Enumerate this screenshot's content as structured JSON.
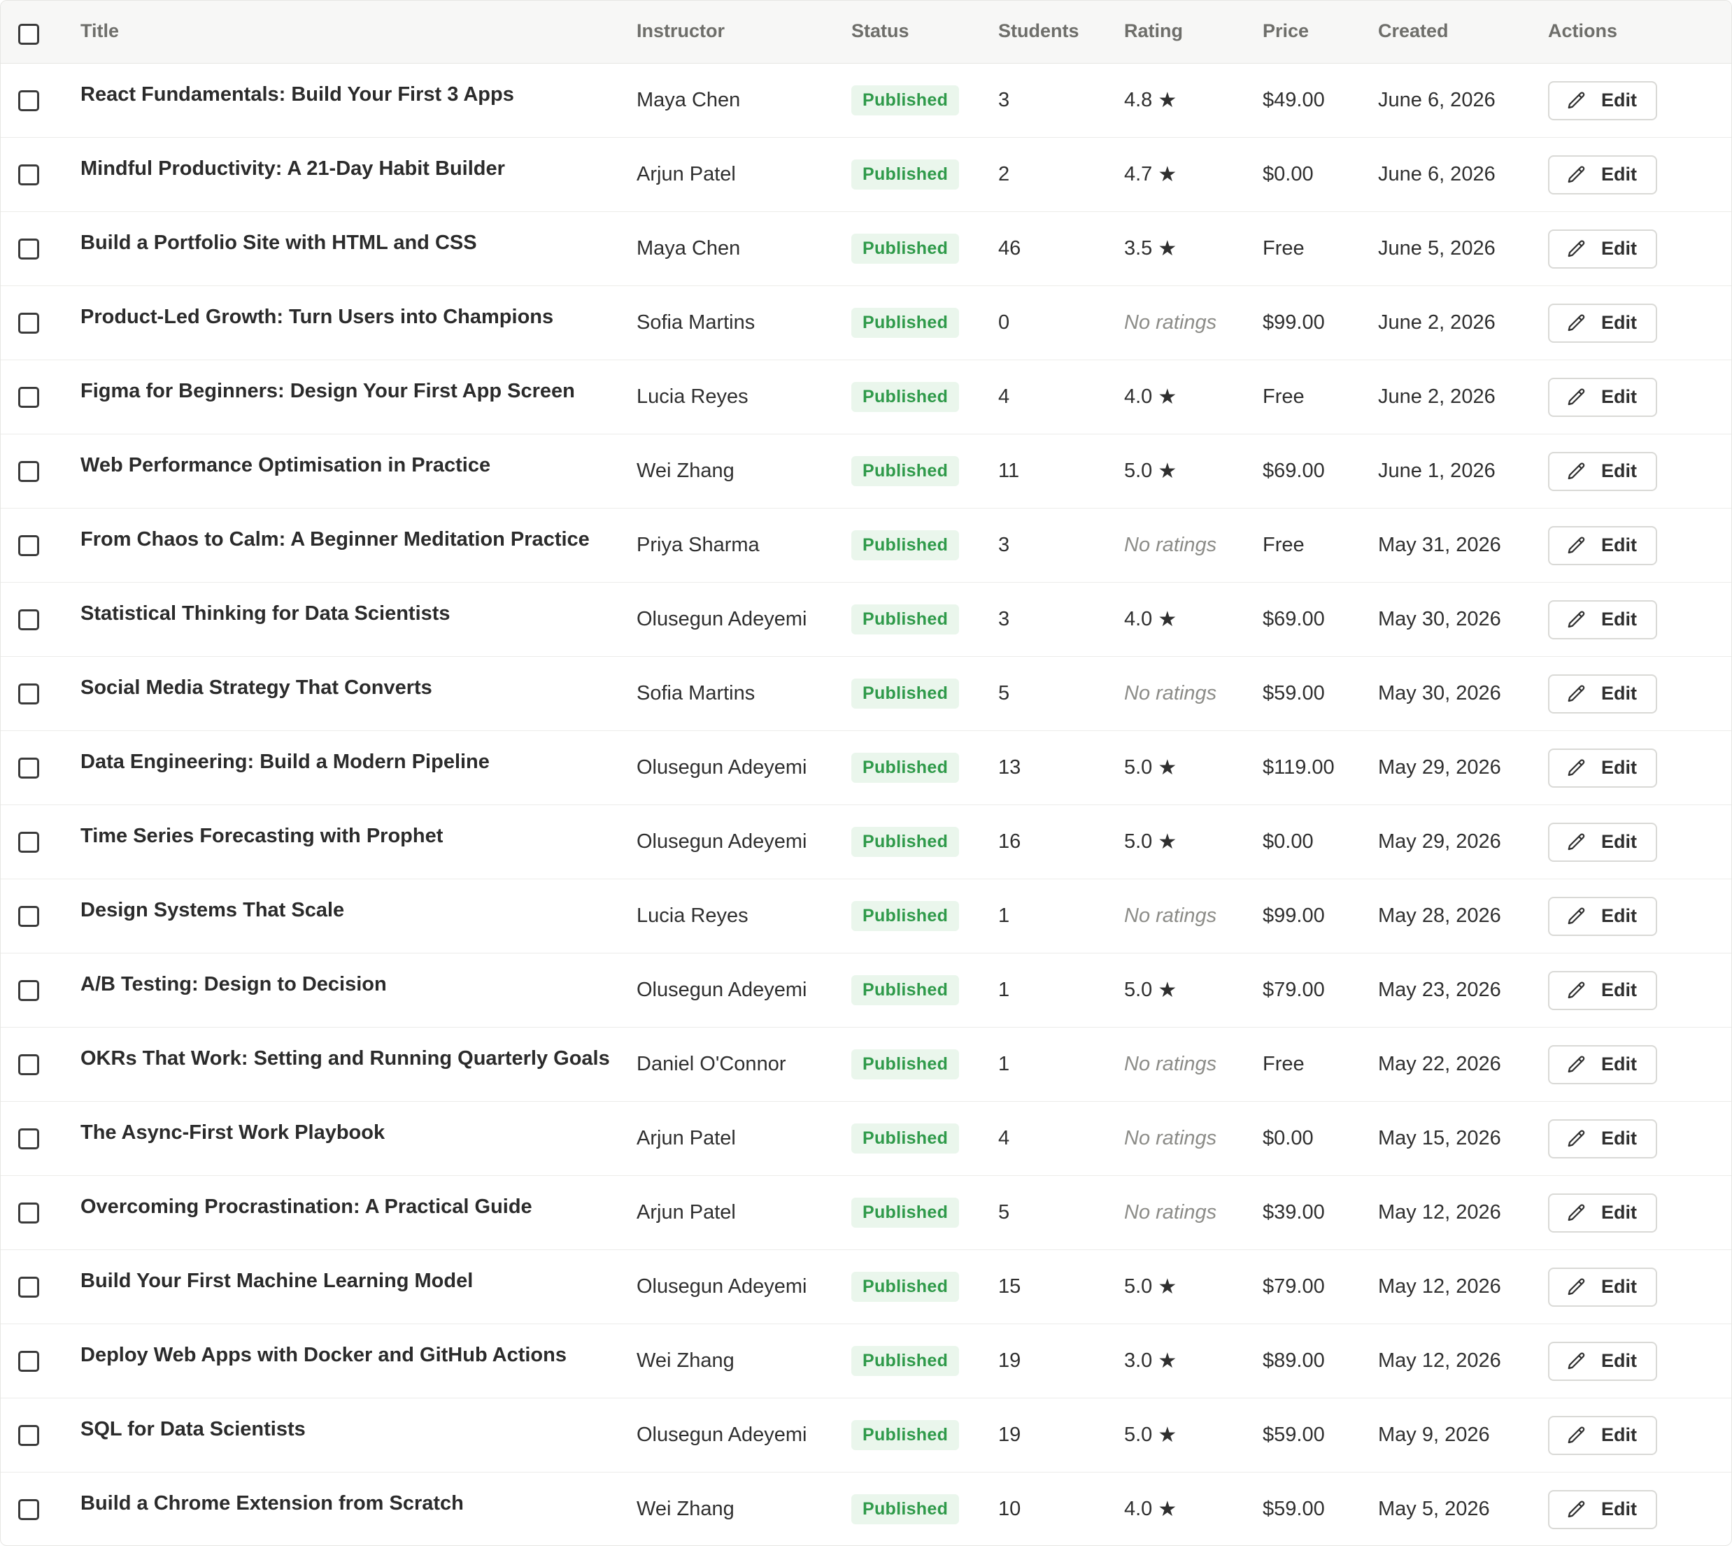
{
  "table": {
    "headers": {
      "title": "Title",
      "instructor": "Instructor",
      "status": "Status",
      "students": "Students",
      "rating": "Rating",
      "price": "Price",
      "created": "Created",
      "actions": "Actions"
    },
    "edit_label": "Edit",
    "no_ratings_label": "No ratings",
    "colors": {
      "badge_bg": "#eaf6ec",
      "badge_text": "#2f9a4a",
      "header_bg": "#f7f7f6"
    },
    "rows": [
      {
        "title": "React Fundamentals: Build Your First 3 Apps",
        "instructor": "Maya Chen",
        "status": "Published",
        "students": "3",
        "rating": "4.8",
        "price": "$49.00",
        "created": "June 6, 2026"
      },
      {
        "title": "Mindful Productivity: A 21-Day Habit Builder",
        "instructor": "Arjun Patel",
        "status": "Published",
        "students": "2",
        "rating": "4.7",
        "price": "$0.00",
        "created": "June 6, 2026"
      },
      {
        "title": "Build a Portfolio Site with HTML and CSS",
        "instructor": "Maya Chen",
        "status": "Published",
        "students": "46",
        "rating": "3.5",
        "price": "Free",
        "created": "June 5, 2026"
      },
      {
        "title": "Product-Led Growth: Turn Users into Champions",
        "instructor": "Sofia Martins",
        "status": "Published",
        "students": "0",
        "rating": null,
        "price": "$99.00",
        "created": "June 2, 2026"
      },
      {
        "title": "Figma for Beginners: Design Your First App Screen",
        "instructor": "Lucia Reyes",
        "status": "Published",
        "students": "4",
        "rating": "4.0",
        "price": "Free",
        "created": "June 2, 2026"
      },
      {
        "title": "Web Performance Optimisation in Practice",
        "instructor": "Wei Zhang",
        "status": "Published",
        "students": "11",
        "rating": "5.0",
        "price": "$69.00",
        "created": "June 1, 2026"
      },
      {
        "title": "From Chaos to Calm: A Beginner Meditation Practice",
        "instructor": "Priya Sharma",
        "status": "Published",
        "students": "3",
        "rating": null,
        "price": "Free",
        "created": "May 31, 2026"
      },
      {
        "title": "Statistical Thinking for Data Scientists",
        "instructor": "Olusegun Adeyemi",
        "status": "Published",
        "students": "3",
        "rating": "4.0",
        "price": "$69.00",
        "created": "May 30, 2026"
      },
      {
        "title": "Social Media Strategy That Converts",
        "instructor": "Sofia Martins",
        "status": "Published",
        "students": "5",
        "rating": null,
        "price": "$59.00",
        "created": "May 30, 2026"
      },
      {
        "title": "Data Engineering: Build a Modern Pipeline",
        "instructor": "Olusegun Adeyemi",
        "status": "Published",
        "students": "13",
        "rating": "5.0",
        "price": "$119.00",
        "created": "May 29, 2026"
      },
      {
        "title": "Time Series Forecasting with Prophet",
        "instructor": "Olusegun Adeyemi",
        "status": "Published",
        "students": "16",
        "rating": "5.0",
        "price": "$0.00",
        "created": "May 29, 2026"
      },
      {
        "title": "Design Systems That Scale",
        "instructor": "Lucia Reyes",
        "status": "Published",
        "students": "1",
        "rating": null,
        "price": "$99.00",
        "created": "May 28, 2026"
      },
      {
        "title": "A/B Testing: Design to Decision",
        "instructor": "Olusegun Adeyemi",
        "status": "Published",
        "students": "1",
        "rating": "5.0",
        "price": "$79.00",
        "created": "May 23, 2026"
      },
      {
        "title": "OKRs That Work: Setting and Running Quarterly Goals",
        "instructor": "Daniel O'Connor",
        "status": "Published",
        "students": "1",
        "rating": null,
        "price": "Free",
        "created": "May 22, 2026"
      },
      {
        "title": "The Async-First Work Playbook",
        "instructor": "Arjun Patel",
        "status": "Published",
        "students": "4",
        "rating": null,
        "price": "$0.00",
        "created": "May 15, 2026"
      },
      {
        "title": "Overcoming Procrastination: A Practical Guide",
        "instructor": "Arjun Patel",
        "status": "Published",
        "students": "5",
        "rating": null,
        "price": "$39.00",
        "created": "May 12, 2026"
      },
      {
        "title": "Build Your First Machine Learning Model",
        "instructor": "Olusegun Adeyemi",
        "status": "Published",
        "students": "15",
        "rating": "5.0",
        "price": "$79.00",
        "created": "May 12, 2026"
      },
      {
        "title": "Deploy Web Apps with Docker and GitHub Actions",
        "instructor": "Wei Zhang",
        "status": "Published",
        "students": "19",
        "rating": "3.0",
        "price": "$89.00",
        "created": "May 12, 2026"
      },
      {
        "title": "SQL for Data Scientists",
        "instructor": "Olusegun Adeyemi",
        "status": "Published",
        "students": "19",
        "rating": "5.0",
        "price": "$59.00",
        "created": "May 9, 2026"
      },
      {
        "title": "Build a Chrome Extension from Scratch",
        "instructor": "Wei Zhang",
        "status": "Published",
        "students": "10",
        "rating": "4.0",
        "price": "$59.00",
        "created": "May 5, 2026"
      }
    ]
  }
}
